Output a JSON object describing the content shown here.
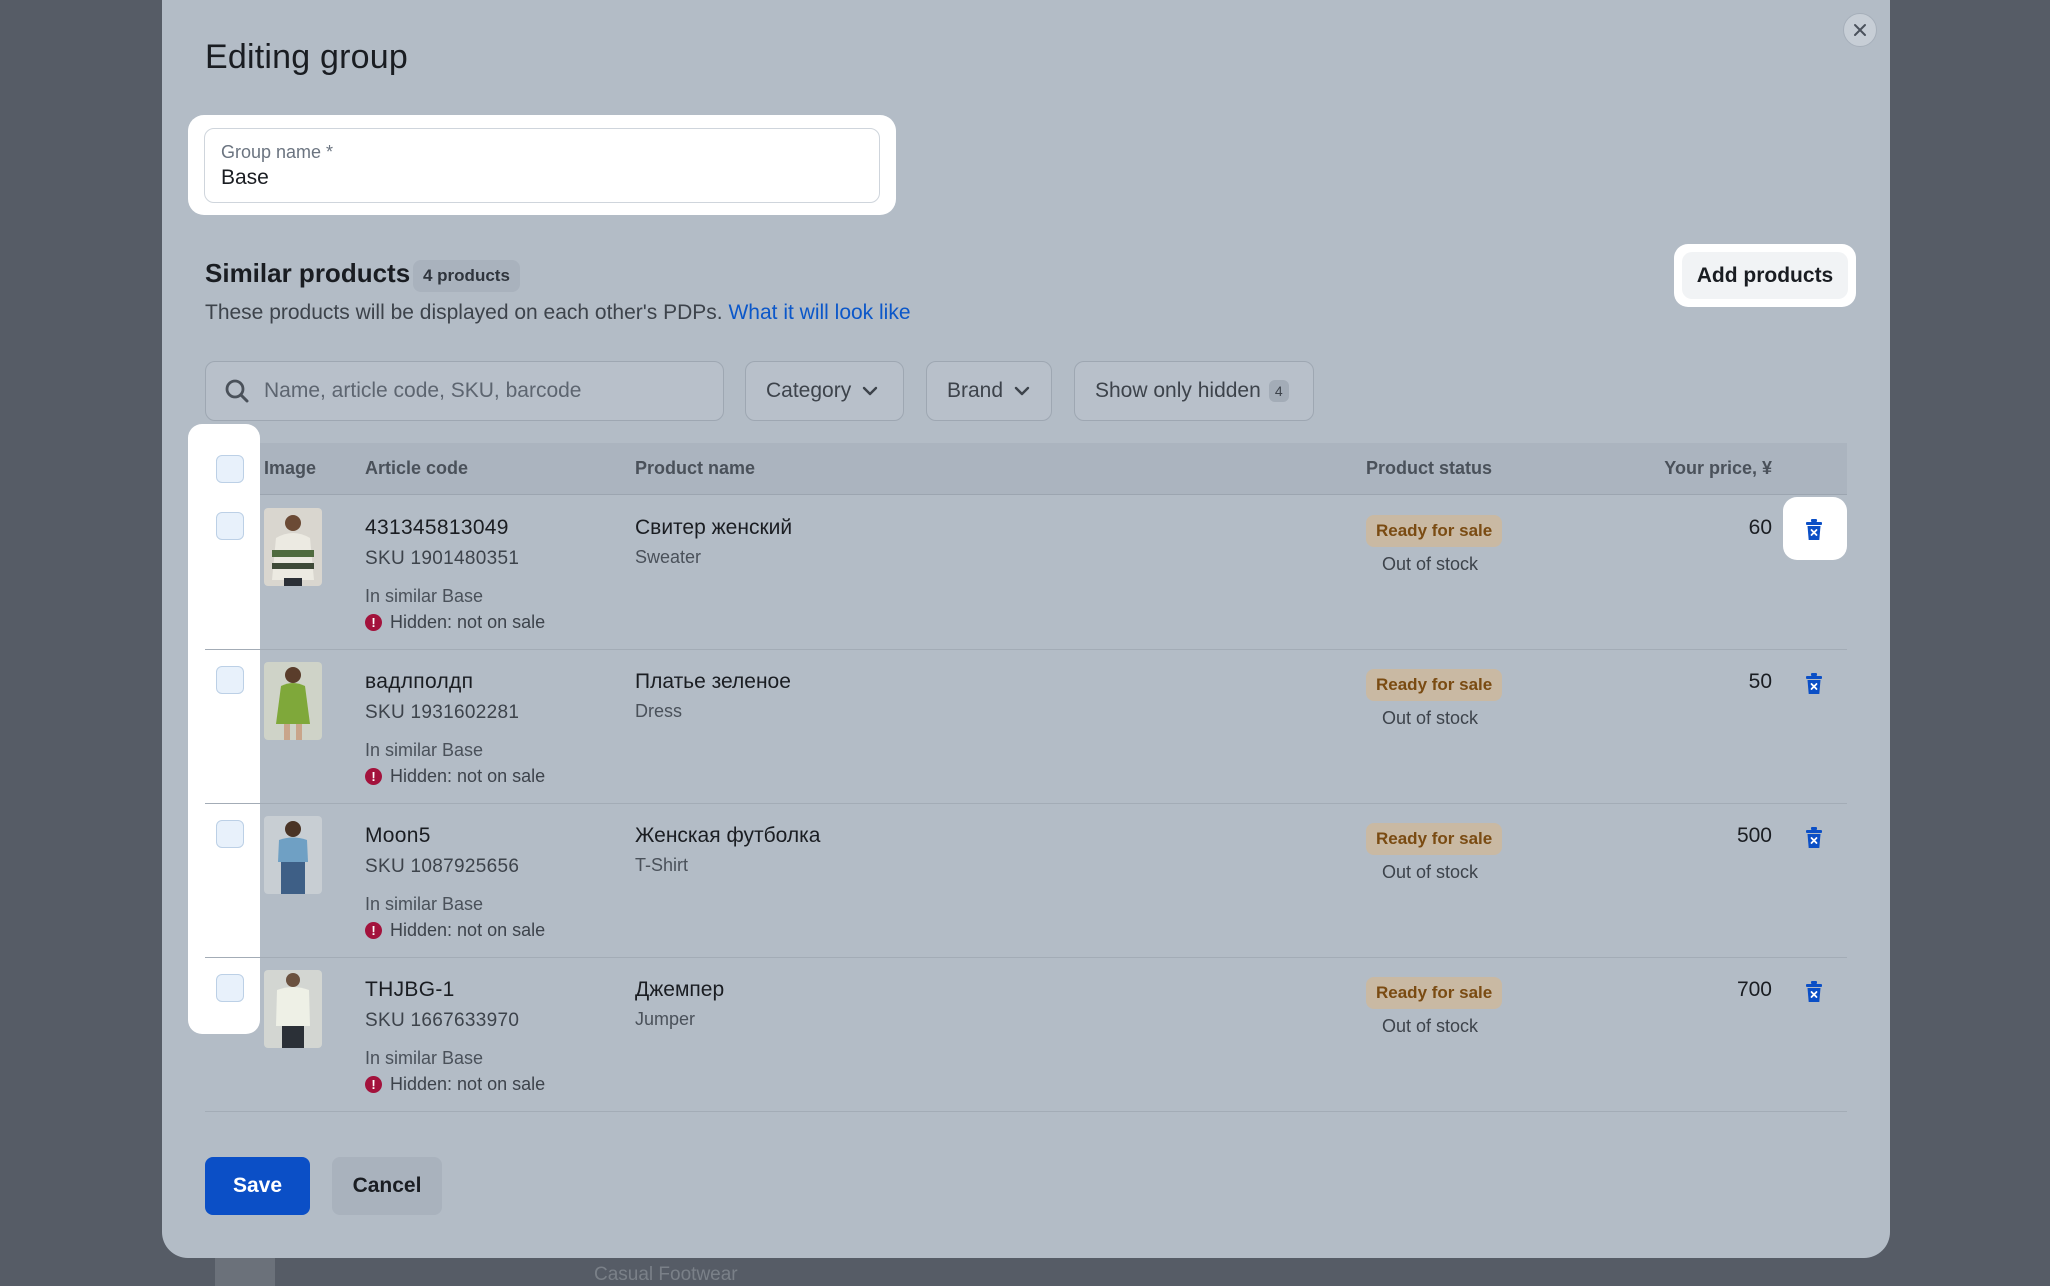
{
  "background": {
    "row_text": "Casual Footwear"
  },
  "modal": {
    "title": "Editing group",
    "close_icon": "close-icon"
  },
  "group_name": {
    "label": "Group name *",
    "value": "Base"
  },
  "similar": {
    "title": "Similar products",
    "count_badge": "4 products",
    "description": "These products will be displayed on each other's PDPs.",
    "link": "What it will look like",
    "add_button": "Add products"
  },
  "filters": {
    "search_placeholder": "Name, article code, SKU, barcode",
    "category": "Category",
    "brand": "Brand",
    "show_hidden": "Show only hidden",
    "show_hidden_count": "4"
  },
  "table": {
    "headers": {
      "image": "Image",
      "article": "Article code",
      "name": "Product name",
      "status": "Product status",
      "price": "Your price, ¥"
    },
    "rows": [
      {
        "article": "431345813049",
        "sku": "SKU 1901480351",
        "in_similar": "In similar Base",
        "hidden_note": "Hidden: not on sale",
        "name": "Свитер женский",
        "category": "Sweater",
        "status": "Ready for sale",
        "stock": "Out of stock",
        "price": "60"
      },
      {
        "article": "вадлполдп",
        "sku": "SKU 1931602281",
        "in_similar": "In similar Base",
        "hidden_note": "Hidden: not on sale",
        "name": "Платье зеленое",
        "category": "Dress",
        "status": "Ready for sale",
        "stock": "Out of stock",
        "price": "50"
      },
      {
        "article": "Moon5",
        "sku": "SKU 1087925656",
        "in_similar": "In similar Base",
        "hidden_note": "Hidden: not on sale",
        "name": "Женская футболка",
        "category": "T-Shirt",
        "status": "Ready for sale",
        "stock": "Out of stock",
        "price": "500"
      },
      {
        "article": "THJBG-1",
        "sku": "SKU 1667633970",
        "in_similar": "In similar Base",
        "hidden_note": "Hidden: not on sale",
        "name": "Джемпер",
        "category": "Jumper",
        "status": "Ready for sale",
        "stock": "Out of stock",
        "price": "700"
      }
    ]
  },
  "footer": {
    "save": "Save",
    "cancel": "Cancel"
  },
  "colors": {
    "accent": "#0b4fc6",
    "link": "#0b57c9",
    "warning": "#a3123c",
    "status_text": "#7a4b12"
  }
}
